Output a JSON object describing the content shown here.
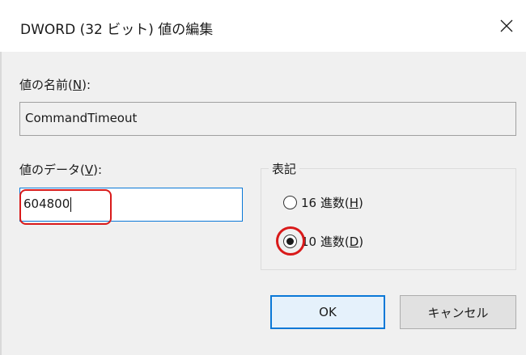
{
  "window": {
    "title": "DWORD (32 ビット) 値の編集",
    "close_icon": "close-icon"
  },
  "value_name": {
    "label": "値の名前(",
    "mnemonic": "N",
    "label_suffix": "):",
    "value": "CommandTimeout"
  },
  "value_data": {
    "label": "値のデータ(",
    "mnemonic": "V",
    "label_suffix": "):",
    "value": "604800"
  },
  "base": {
    "title": "表記",
    "options": [
      {
        "label": "16 進数(",
        "mnemonic": "H",
        "suffix": ")",
        "checked": false
      },
      {
        "label": "10 進数(",
        "mnemonic": "D",
        "suffix": ")",
        "checked": true
      }
    ]
  },
  "buttons": {
    "ok_label": "OK",
    "cancel_label": "キャンセル"
  },
  "colors": {
    "accent": "#0a78d7",
    "annotation_red": "#d91a1a"
  }
}
